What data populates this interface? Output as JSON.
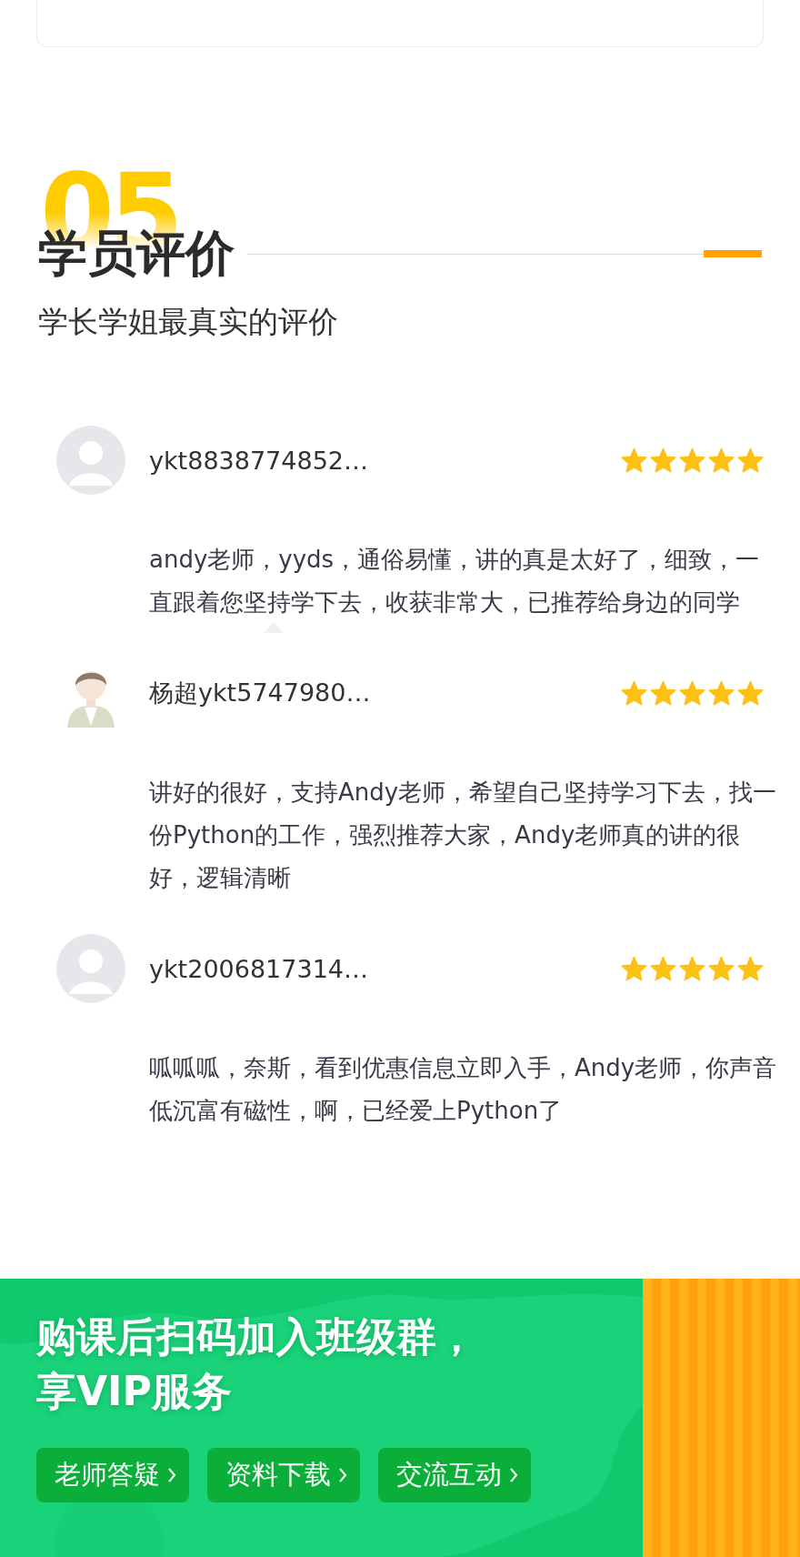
{
  "section": {
    "number": "05",
    "title": "学员评价",
    "subtitle": "学长学姐最真实的评价"
  },
  "reviews": [
    {
      "kind": "default",
      "name": "ykt8838774852…",
      "stars": 5,
      "text": "andy老师，yyds，通俗易懂，讲的真是太好了，细致，一直跟着您坚持学下去，收获非常大，已推荐给身边的同学"
    },
    {
      "kind": "illustration",
      "name": "杨超ykt5747980…",
      "stars": 5,
      "text": "讲好的很好，支持Andy老师，希望自己坚持学习下去，找一份Python的工作，强烈推荐大家，Andy老师真的讲的很好，逻辑清晰"
    },
    {
      "kind": "default",
      "name": "ykt2006817314…",
      "stars": 5,
      "text": "呱呱呱，奈斯，看到优惠信息立即入手，Andy老师，你声音低沉富有磁性，啊，已经爱上Python了"
    }
  ],
  "banner": {
    "title_lines": [
      "购课后扫码加入班级群，",
      "享VIP服务"
    ],
    "buttons": [
      "老师答疑",
      "资料下载",
      "交流互动"
    ]
  }
}
